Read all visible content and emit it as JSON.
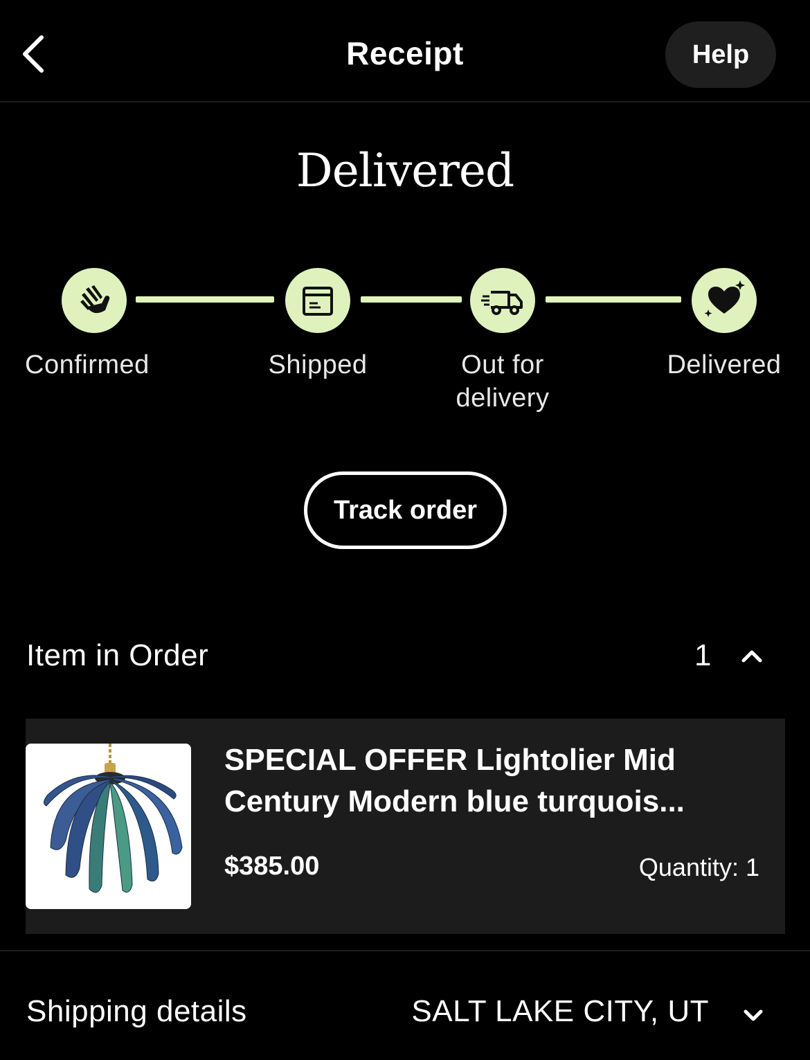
{
  "header": {
    "title": "Receipt",
    "help_label": "Help"
  },
  "status": {
    "heading": "Delivered"
  },
  "steps": [
    {
      "label": "Confirmed",
      "icon": "waving-hand-icon"
    },
    {
      "label": "Shipped",
      "icon": "package-icon"
    },
    {
      "label": "Out for delivery",
      "label_line1": "Out for",
      "label_line2": "delivery",
      "icon": "delivery-truck-icon"
    },
    {
      "label": "Delivered",
      "icon": "heart-sparkle-icon"
    }
  ],
  "track_order_label": "Track order",
  "items_section": {
    "title": "Item in Order",
    "count": "1",
    "expanded": true
  },
  "item": {
    "title": "SPECIAL OFFER Lightolier Mid Century Modern blue turquois...",
    "price": "$385.00",
    "quantity": "Quantity: 1",
    "thumbnail": "blue-turquoise-pendant-lamp"
  },
  "shipping": {
    "label": "Shipping details",
    "value": "SALT LAKE CITY, UT"
  },
  "colors": {
    "background": "#000000",
    "accent": "#dff2bd",
    "card": "#1c1c1c",
    "help_bg": "#1f1f1f"
  }
}
